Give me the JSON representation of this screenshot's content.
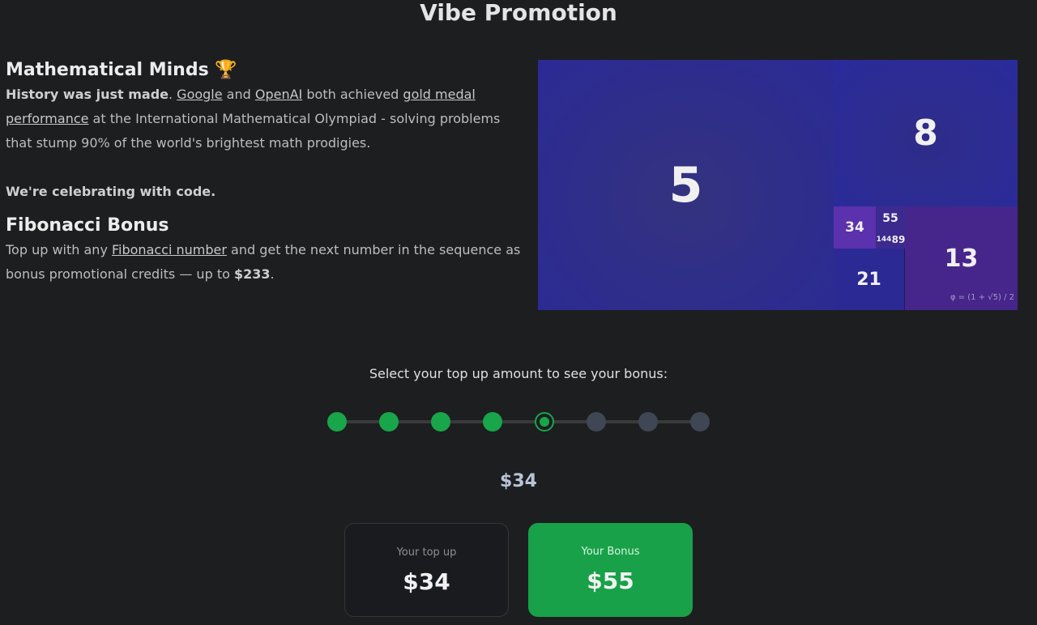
{
  "page": {
    "title": "Vibe Promotion"
  },
  "intro": {
    "heading": "Mathematical Minds 🏆",
    "p1_bold": "History was just made",
    "p1_sep": ". ",
    "link_google": "Google",
    "p1_and": " and ",
    "link_openai": "OpenAI",
    "p1_mid": " both achieved ",
    "link_gold": "gold medal performance",
    "p1_end": " at the International Mathematical Olympiad - solving problems that stump 90% of the world's brightest math prodigies.",
    "p2_bold": "We're celebrating with code."
  },
  "bonus_section": {
    "heading": "Fibonacci Bonus",
    "p_start": "Top up with any ",
    "link_fib": "Fibonacci number",
    "p_mid": " and get the next number in the sequence as bonus promotional credits — up to ",
    "p_max": "$233",
    "p_end": "."
  },
  "fib_art": {
    "tiles": [
      "5",
      "8",
      "13",
      "21",
      "34",
      "55",
      "89",
      "144"
    ],
    "formula": "φ = (1 + √5) / 2",
    "colors": {
      "background": "#2b2a86",
      "accent_purple": "#5b31ad"
    }
  },
  "selector": {
    "label": "Select your top up amount to see your bonus:",
    "stop_count": 8,
    "selected_index": 4,
    "selected_amount": "$34",
    "colors": {
      "active": "#19a54a",
      "inactive": "#3f4654"
    }
  },
  "cards": {
    "topup_label": "Your top up",
    "topup_value": "$34",
    "bonus_label": "Your Bonus",
    "bonus_value": "$55"
  }
}
